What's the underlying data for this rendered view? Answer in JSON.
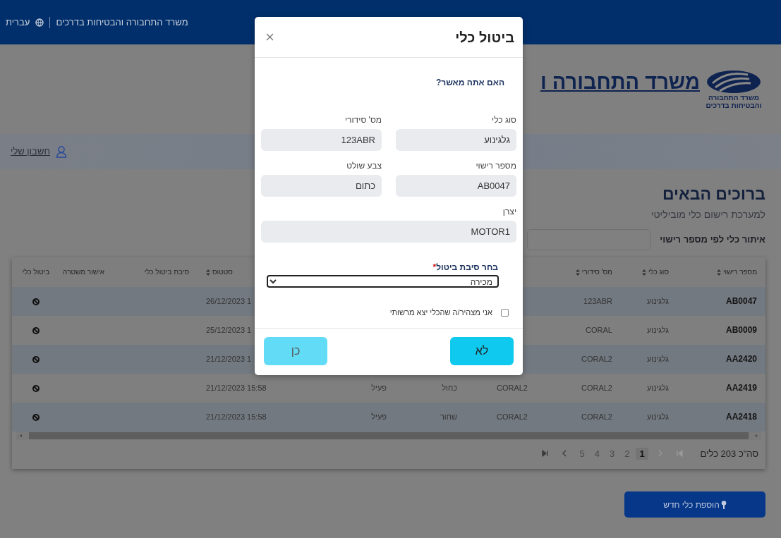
{
  "topbar": {
    "site_name": "משרד התחבורה והבטיחות בדרכים",
    "language": "עברית"
  },
  "brand": {
    "logo_text": [
      "משרד התחבורה",
      "והבטיחות בדרכים"
    ],
    "title": "משרד התחבורה ו"
  },
  "account_link": "חשבון שלי",
  "welcome": {
    "title": "ברוכים הבאים",
    "subtitle": "למערכת רישום כלי מוביליטי"
  },
  "search": {
    "label": "איתור כלי לפי מספר רישוי"
  },
  "table": {
    "columns": [
      {
        "label": "מספר רישוי",
        "sortable": true,
        "kind": "text"
      },
      {
        "label": "סוג כלי",
        "sortable": true,
        "kind": "text"
      },
      {
        "label": "מס' סידורי",
        "sortable": true,
        "kind": "text"
      },
      null,
      null,
      null,
      {
        "label": "סטטוס",
        "sortable": true,
        "kind": "text"
      },
      {
        "label": "סיבת ביטול כלי",
        "sortable": false,
        "kind": "text"
      },
      {
        "label": "אישור משטרה",
        "sortable": false,
        "kind": "text"
      },
      {
        "label": "ביטול כלי",
        "sortable": false,
        "kind": "action"
      }
    ],
    "rows": [
      [
        "AB0047",
        "גלגינוע",
        "123ABR",
        null,
        null,
        null,
        "26/12/2023 1",
        null,
        null,
        null
      ],
      [
        "AB0009",
        "גלגינוע",
        "CORAL",
        null,
        null,
        null,
        "25/12/2023 1",
        null,
        null,
        null
      ],
      [
        "AA2420",
        "גלגינוע",
        "CORAL2",
        null,
        null,
        null,
        "21/12/2023 1",
        null,
        null,
        null
      ],
      [
        "AA2419",
        "גלגינוע",
        "CORAL2",
        "CORAL2",
        "כחול",
        "פעיל",
        "21/12/2023 15:58",
        null,
        null,
        null
      ],
      [
        "AA2418",
        "גלגינוע",
        "CORAL2",
        "CORAL2",
        "שחור",
        "פעיל",
        "21/12/2023 15:58",
        null,
        null,
        null
      ]
    ]
  },
  "pagination": {
    "total": "סה\"כ 203 כלים",
    "before": [
      {
        "kind": "first",
        "disabled": true
      },
      {
        "kind": "prev",
        "disabled": true
      }
    ],
    "pages": [
      {
        "label": "1",
        "selected": true
      },
      {
        "label": "2",
        "selected": false
      },
      {
        "label": "3",
        "selected": false
      },
      {
        "label": "4",
        "selected": false
      },
      {
        "label": "5",
        "selected": false
      }
    ],
    "after": [
      {
        "kind": "next",
        "disabled": false
      },
      {
        "kind": "last",
        "disabled": false
      }
    ]
  },
  "add_button": "הוספת כלי חדש",
  "modal": {
    "title": "ביטול כלי",
    "question": "האם אתה מאשר?",
    "fields": [
      {
        "label": "סוג כלי",
        "value": "גלגינוע",
        "wide": false
      },
      {
        "label": "מס' סידורי",
        "value": "123ABR",
        "wide": false
      },
      {
        "label": "מספר רישוי",
        "value": "AB0047",
        "wide": false
      },
      {
        "label": "צבע שולט",
        "value": "כתום",
        "wide": false
      },
      {
        "label": "יצרן",
        "value": "MOTOR1",
        "wide": true
      }
    ],
    "reason": {
      "label": "בחר סיבת ביטול",
      "required_mark": "*",
      "value": "מכירה"
    },
    "declaration": {
      "label": "אני מצהיר/ה שהכלי יצא מרשותי",
      "checked": false
    },
    "buttons": [
      {
        "label": "לא",
        "disabled": false
      },
      {
        "label": "כן",
        "disabled": true
      }
    ]
  }
}
